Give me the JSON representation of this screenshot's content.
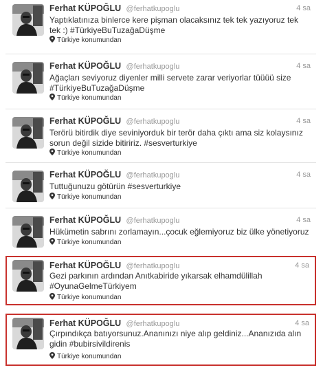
{
  "tweets": [
    {
      "fullname": "Ferhat KÜPOĞLU",
      "username": "@ferhatkupoglu",
      "time": "4 sa",
      "text": "Yaptıklatınıza binlerce kere pişman olacaksınız tek tek yazıyoruz tek tek :) #TürkiyeBuTuzağaDüşme",
      "location": "Türkiye konumundan",
      "highlighted": false
    },
    {
      "fullname": "Ferhat KÜPOĞLU",
      "username": "@ferhatkupoglu",
      "time": "4 sa",
      "text": "Ağaçları seviyoruz diyenler milli servete zarar veriyorlar tüüüü size #TürkiyeBuTuzağaDüşme",
      "location": "Türkiye konumundan",
      "highlighted": false
    },
    {
      "fullname": "Ferhat KÜPOĞLU",
      "username": "@ferhatkupoglu",
      "time": "4 sa",
      "text": "Terörü bitirdik diye seviniyorduk bir terör daha çıktı ama siz kolaysınız sorun değil sizide bitiririz. #sesverturkiye",
      "location": "Türkiye konumundan",
      "highlighted": false
    },
    {
      "fullname": "Ferhat KÜPOĞLU",
      "username": "@ferhatkupoglu",
      "time": "4 sa",
      "text": "Tuttuğunuzu götürün #sesverturkiye",
      "location": "Türkiye konumundan",
      "highlighted": false
    },
    {
      "fullname": "Ferhat KÜPOĞLU",
      "username": "@ferhatkupoglu",
      "time": "4 sa",
      "text": "Hükümetin sabrını zorlamayın...çocuk eğlemiyoruz biz ülke yönetiyoruz",
      "location": "Türkiye konumundan",
      "highlighted": false
    },
    {
      "fullname": "Ferhat KÜPOĞLU",
      "username": "@ferhatkupoglu",
      "time": "4 sa",
      "text": "Gezi parkının ardından Anıtkabiride yıkarsak elhamdülillah #OyunaGelmeTürkiyem",
      "location": "Türkiye konumundan",
      "highlighted": true
    },
    {
      "fullname": "Ferhat KÜPOĞLU",
      "username": "@ferhatkupoglu",
      "time": "4 sa",
      "text": "Çırpındıkça batıyorsunuz.Ananınızı niye alıp geldiniz...Ananızıda alın gidin #bubirsivildirenis",
      "location": "Türkiye konumundan",
      "highlighted": true
    }
  ],
  "colors": {
    "highlight_border": "#c8312d",
    "muted_text": "#999999",
    "body_text": "#333333",
    "divider": "#e2e2e2"
  },
  "icons": {
    "avatar": "profile-photo",
    "location": "map-pin-icon"
  }
}
